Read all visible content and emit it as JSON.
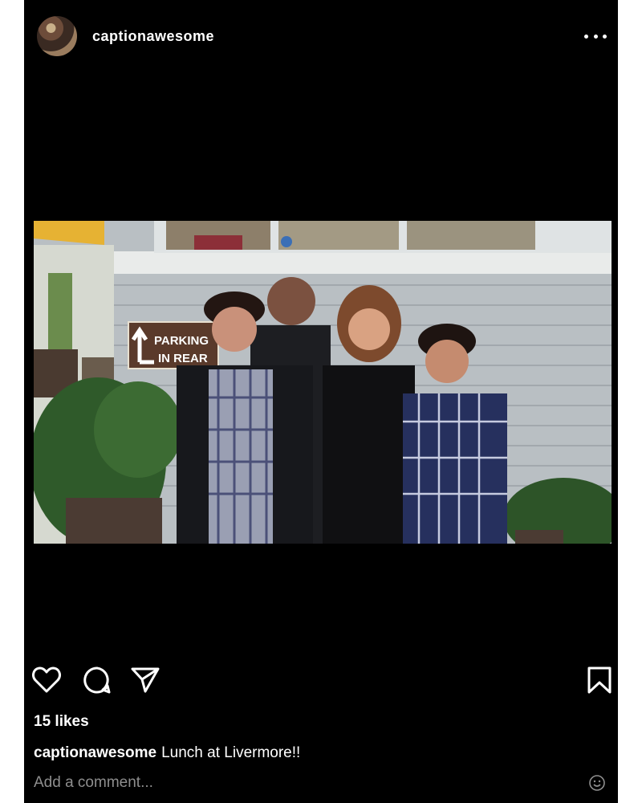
{
  "post": {
    "username": "captionawesome",
    "more_icon": "more-horizontal-icon",
    "photo": {
      "sign_text": [
        "PARKING",
        "IN REAR"
      ]
    },
    "actions": {
      "like_icon": "heart-icon",
      "comment_icon": "comment-bubble-icon",
      "share_icon": "paper-plane-icon",
      "save_icon": "bookmark-icon"
    },
    "likes": "15 likes",
    "caption": {
      "username": "captionawesome",
      "text": "Lunch at Livermore!!"
    },
    "comment": {
      "placeholder": "Add a comment...",
      "emoji_icon": "smiley-icon"
    }
  },
  "colors": {
    "background": "#000000",
    "text": "#ffffff",
    "placeholder": "#8e8e8e",
    "page": "#ffffff"
  }
}
